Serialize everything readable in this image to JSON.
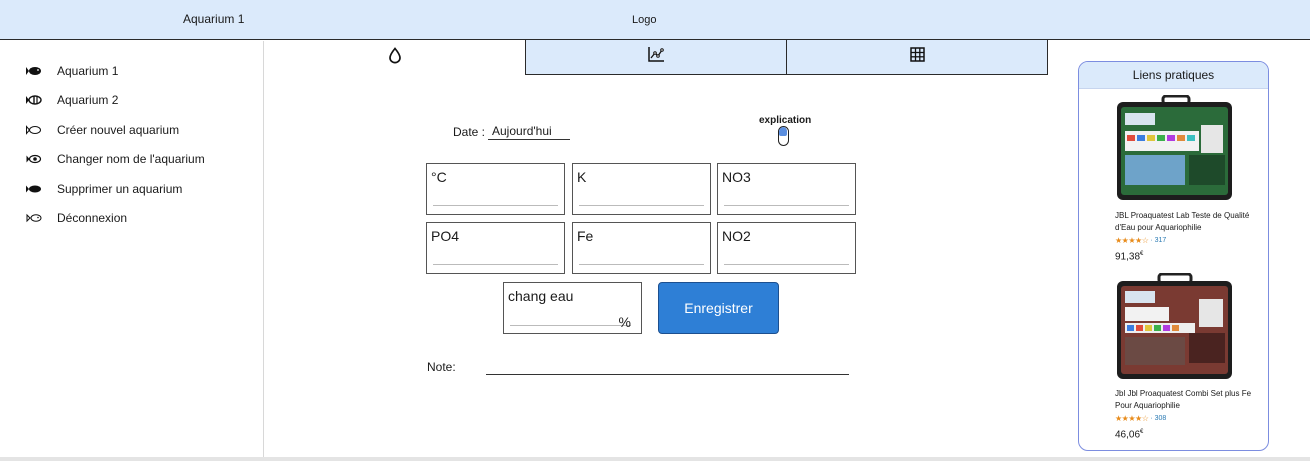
{
  "header": {
    "aquarium_title": "Aquarium 1",
    "logo": "Logo"
  },
  "sidebar": {
    "items": [
      {
        "label": "Aquarium 1",
        "icon": "fish-filled-icon"
      },
      {
        "label": "Aquarium 2",
        "icon": "fish-striped-icon"
      },
      {
        "label": "Créer nouvel aquarium",
        "icon": "fish-outline-icon"
      },
      {
        "label": "Changer nom de l'aquarium",
        "icon": "fish-eye-icon"
      },
      {
        "label": "Supprimer un aquarium",
        "icon": "fish-filled-icon"
      },
      {
        "label": "Déconnexion",
        "icon": "fish-outline-icon"
      }
    ]
  },
  "tabs": [
    {
      "name": "water-tests",
      "icon": "water-drop-icon",
      "active": true
    },
    {
      "name": "graph",
      "icon": "chart-icon",
      "active": false
    },
    {
      "name": "table",
      "icon": "table-icon",
      "active": false
    }
  ],
  "form": {
    "date_label": "Date :",
    "date_value": "Aujourd'hui",
    "explanation_label": "explication",
    "params": [
      "°C",
      "K",
      "NO3",
      "PO4",
      "Fe",
      "NO2"
    ],
    "water_change_label": "chang eau",
    "water_change_unit": "%",
    "save_label": "Enregistrer",
    "note_label": "Note:"
  },
  "links": {
    "title": "Liens pratiques",
    "products": [
      {
        "name": "JBL Proaquatest Lab Teste de Qualité d'Eau pour Aquariophilie",
        "stars": "★★★★☆",
        "reviews": "317",
        "price": "91,38",
        "currency": "€",
        "case_color": "#2b6b3a"
      },
      {
        "name": "Jbl Jbl Proaquatest Combi Set plus Fe Pour Aquariophilie",
        "stars": "★★★★☆",
        "reviews": "308",
        "price": "46,06",
        "currency": "€",
        "case_color": "#7a3a32"
      }
    ]
  },
  "colors": {
    "header_bg": "#dbeafb",
    "accent": "#2e7fd6",
    "links_border": "#7c8de0",
    "stars": "#e88b1a"
  }
}
